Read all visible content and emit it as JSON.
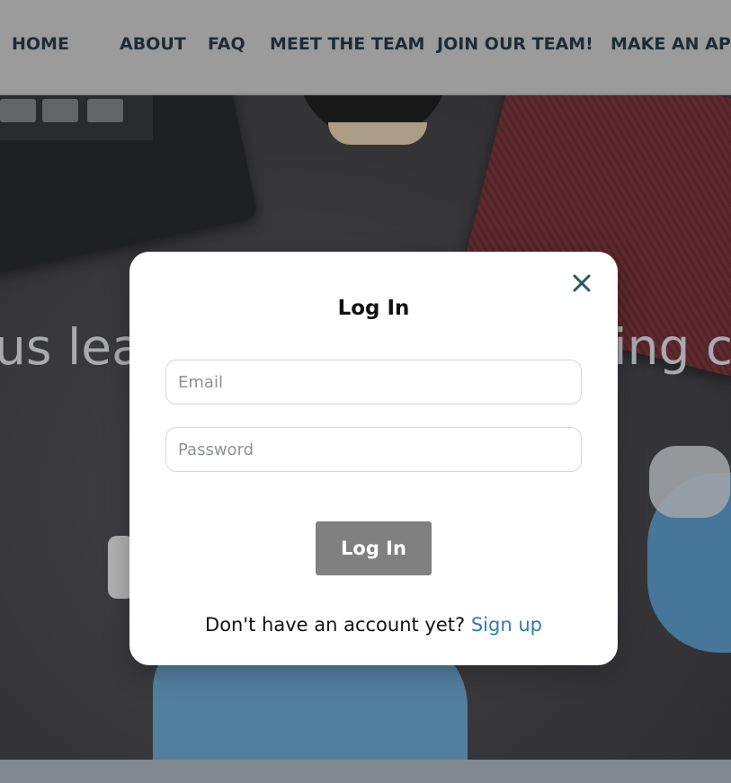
{
  "nav": {
    "items": [
      {
        "label": "HOME"
      },
      {
        "label": "ABOUT"
      },
      {
        "label": "FAQ"
      },
      {
        "label": "MEET THE TEAM"
      },
      {
        "label": "JOIN OUR TEAM!"
      },
      {
        "label": "MAKE AN APP"
      }
    ]
  },
  "hero": {
    "text": "us lea                              ing c"
  },
  "modal": {
    "title": "Log In",
    "close_icon": "close-icon",
    "email_placeholder": "Email",
    "email_value": "",
    "password_placeholder": "Password",
    "password_value": "",
    "submit_label": "Log In",
    "signup_prompt": "Don't have an account yet?",
    "signup_link": "Sign up"
  },
  "colors": {
    "accent_link": "#2f7fa3",
    "close_icon": "#2b5a5f",
    "button_bg": "#808080",
    "nav_bg": "#9b9b9b"
  }
}
